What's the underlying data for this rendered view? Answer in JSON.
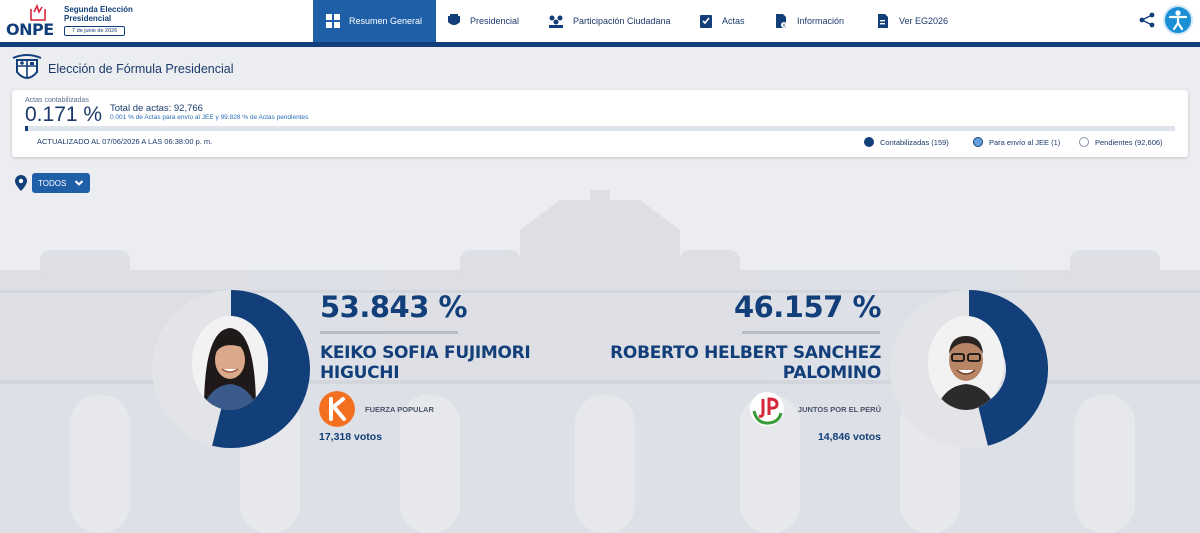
{
  "header": {
    "logo_text": "ONPE",
    "election_title": "Segunda Elección Presidencial",
    "election_date": "7 de junio de 2026",
    "nav": [
      {
        "label": "Resumen General",
        "icon": "dashboard-icon",
        "active": true
      },
      {
        "label": "Presidencial",
        "icon": "presidential-shield-icon",
        "active": false
      },
      {
        "label": "Participación Ciudadana",
        "icon": "people-icon",
        "active": false
      },
      {
        "label": "Actas",
        "icon": "checklist-icon",
        "active": false
      },
      {
        "label": "Información",
        "icon": "info-document-icon",
        "active": false
      },
      {
        "label": "Ver EG2026",
        "icon": "document-icon",
        "active": false
      }
    ],
    "share_icon": "share-icon",
    "accessibility_icon": "accessibility-icon"
  },
  "page": {
    "title": "Elección de Fórmula Presidencial"
  },
  "stats": {
    "actas_label": "Actas contabilizadas",
    "actas_percent": "0.171 %",
    "progress": 0.00171,
    "total_label": "Total de actas: 92,766",
    "total_sub": "0.001 % de Actas para envío al JEE y 99.828 % de Actas pendientes",
    "updated": "ACTUALIZADO AL 07/06/2026 A LAS 06:38:00 p. m.",
    "legend": [
      {
        "label": "Contabilizadas (159)",
        "style": "filled"
      },
      {
        "label": "Para envío al JEE (1)",
        "style": "light"
      },
      {
        "label": "Pendientes (92,606)",
        "style": "empty"
      }
    ]
  },
  "filter": {
    "label": "TODOS"
  },
  "colors": {
    "primary": "#123f7a",
    "nav_active": "#1f5fa8",
    "donut_empty": "#e3e4e8"
  },
  "candidates": [
    {
      "percent": "53.843 %",
      "share": 0.53843,
      "name_line1": "KEIKO SOFIA FUJIMORI",
      "name_line2": "HIGUCHI",
      "party": "FUERZA POPULAR",
      "votes": "17,318 votos"
    },
    {
      "percent": "46.157 %",
      "share": 0.46157,
      "name_line1": "ROBERTO HELBERT SANCHEZ",
      "name_line2": "PALOMINO",
      "party": "JUNTOS POR EL PERÚ",
      "votes": "14,846 votos"
    }
  ]
}
